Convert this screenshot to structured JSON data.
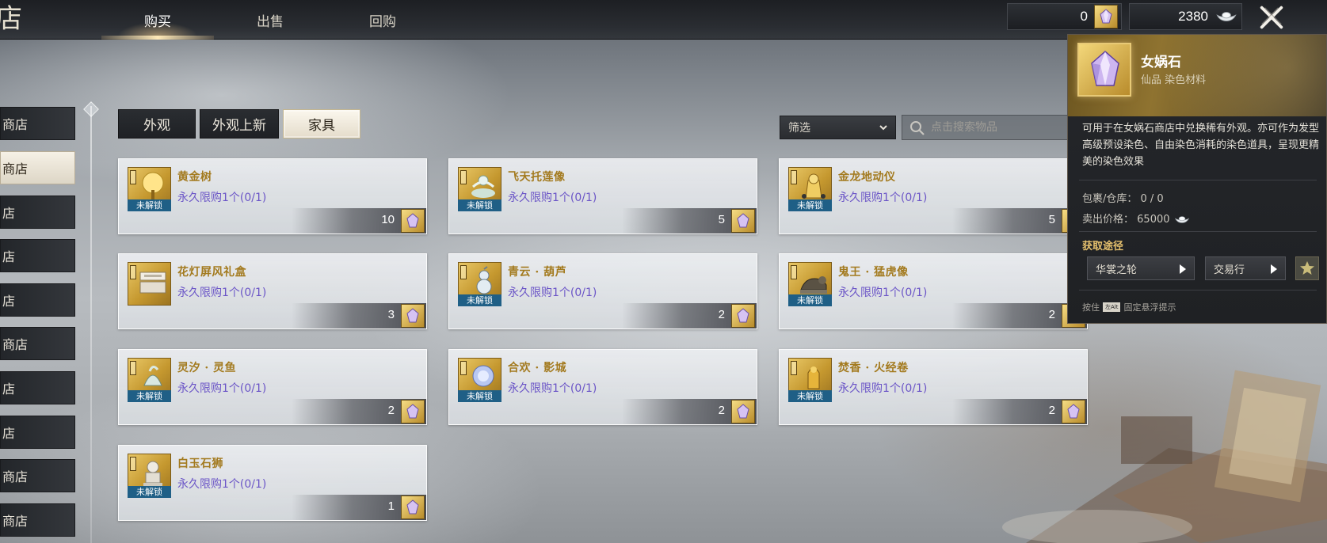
{
  "header": {
    "shop_title_char": "店",
    "tabs": [
      {
        "label": "购买",
        "active": true
      },
      {
        "label": "出售",
        "active": false
      },
      {
        "label": "回购",
        "active": false
      }
    ],
    "currencies": [
      {
        "value": "0",
        "icon": "gem-icon"
      },
      {
        "value": "2380",
        "icon": "silver-ingot-icon"
      }
    ],
    "close_icon": "close-icon"
  },
  "sidebar": {
    "items": [
      {
        "label": "商店",
        "active": false
      },
      {
        "label": "商店",
        "active": true
      },
      {
        "label": "店",
        "active": false
      },
      {
        "label": "店",
        "active": false
      },
      {
        "label": "店",
        "active": false
      },
      {
        "label": "商店",
        "active": false
      },
      {
        "label": "店",
        "active": false
      },
      {
        "label": "店",
        "active": false
      },
      {
        "label": "商店",
        "active": false
      },
      {
        "label": "商店",
        "active": false
      }
    ]
  },
  "subtabs": [
    {
      "label": "外观",
      "active": false
    },
    {
      "label": "外观上新",
      "active": false
    },
    {
      "label": "家具",
      "active": true
    }
  ],
  "filter": {
    "label": "筛选"
  },
  "search": {
    "placeholder": "点击搜索物品"
  },
  "items": [
    {
      "name": "黄金树",
      "limit": "永久限购1个(0/1)",
      "price": "10",
      "tag": "未解锁",
      "icon": "golden-tree-icon"
    },
    {
      "name": "飞天托莲像",
      "limit": "永久限购1个(0/1)",
      "price": "5",
      "tag": "未解锁",
      "icon": "flying-apsara-statue-icon"
    },
    {
      "name": "金龙地动仪",
      "limit": "永久限购1个(0/1)",
      "price": "5",
      "tag": "未解锁",
      "icon": "dragon-seismograph-icon"
    },
    {
      "name": "花灯屏风礼盒",
      "limit": "永久限购1个(0/1)",
      "price": "3",
      "tag": "",
      "icon": "gift-box-icon"
    },
    {
      "name": "青云 · 葫芦",
      "limit": "永久限购1个(0/1)",
      "price": "2",
      "tag": "未解锁",
      "icon": "gourd-icon"
    },
    {
      "name": "鬼王 · 猛虎像",
      "limit": "永久限购1个(0/1)",
      "price": "2",
      "tag": "未解锁",
      "icon": "tiger-statue-icon"
    },
    {
      "name": "灵汐 · 灵鱼",
      "limit": "永久限购1个(0/1)",
      "price": "2",
      "tag": "未解锁",
      "icon": "fish-icon"
    },
    {
      "name": "合欢 · 影城",
      "limit": "永久限购1个(0/1)",
      "price": "2",
      "tag": "未解锁",
      "icon": "shadow-city-icon"
    },
    {
      "name": "焚香 · 火经卷",
      "limit": "永久限购1个(0/1)",
      "price": "2",
      "tag": "未解锁",
      "icon": "fire-scroll-icon"
    },
    {
      "name": "白玉石狮",
      "limit": "永久限购1个(0/1)",
      "price": "1",
      "tag": "未解锁",
      "icon": "stone-lion-icon"
    }
  ],
  "tooltip": {
    "title": "女娲石",
    "subtitle": "仙品  染色材料",
    "description": "可用于在女娲石商店中兑换稀有外观。亦可作为发型高级预设染色、自由染色消耗的染色道具，呈现更精美的染色效果",
    "inventory": "包裹/仓库： 0  /  0",
    "sell_price_label": "卖出价格：",
    "sell_price_value": "65000",
    "source_title": "获取途径",
    "sources": [
      "华裳之轮",
      "交易行"
    ],
    "hint_prefix": "按住",
    "hint_key": "左Alt",
    "hint_suffix": "固定悬浮提示"
  },
  "colors": {
    "item_name": "#a37a1e",
    "limit_text": "#6b55c7",
    "lock_tag": "#1f5f86",
    "gold_accent": "#e6c16e"
  }
}
